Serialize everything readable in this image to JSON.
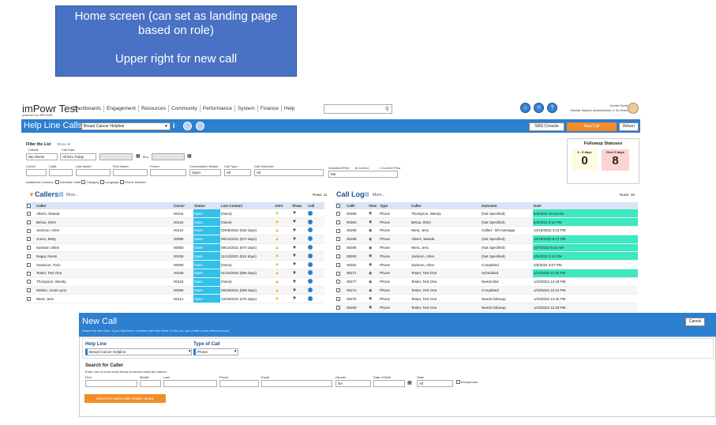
{
  "callout": {
    "line1": "Home screen (can set as landing page",
    "line2": "based on role)",
    "line3": "",
    "line4": "Upper right for new call"
  },
  "app": {
    "logo": "imPowr Test",
    "logo_sub": "powered by IMPOWR",
    "nav": [
      "Dashboards",
      "Engagement",
      "Resources",
      "Community",
      "Performance",
      "System",
      "Finance",
      "Help"
    ],
    "user_name": "Kenish Scott",
    "user_role": "Suicide System Administrator (+ ID Hide)"
  },
  "bar": {
    "title": "Help Line Calls",
    "helpline": "Breast Cancer Helpline",
    "sms": "SMS Console",
    "new_call": "New Call",
    "return": "Return"
  },
  "filter": {
    "title": "Filter the List",
    "show_all": "Show All",
    "clients_label": "Clients:",
    "calldate_label": "Call Date:",
    "clients_value": "My clients",
    "calldate_value": "All thru Today",
    "thru": "thru",
    "conv_label": "Conv#:",
    "call_label": "Call#:",
    "last_label": "Last Name:",
    "first_label": "First Name:",
    "phone_label": "Phone:",
    "convstatus_label": "Conversation Status:",
    "calltype_label": "Call Type:",
    "outcome_label": "Call Outcome:",
    "convstatus_value": "Open",
    "calltype_value": "All",
    "outcome_value": "All",
    "volpeer_label": "Volunteer/Peer:",
    "current": "Current",
    "currentprior": "Current+Prior",
    "volpeer_value": "Me",
    "addl_label": "Additional Columns:",
    "addl": [
      "Volunteer Note",
      "Category",
      "Language",
      "Phone Number"
    ]
  },
  "followup": {
    "title": "Followup Statuses",
    "a_label": "3 - 5 days",
    "a_value": "0",
    "b_label": "Over 5 days",
    "b_value": "8"
  },
  "callers": {
    "title": "Callers",
    "more": "More...",
    "rows_label": "Rows: 11",
    "headers": [
      "Caller",
      "Conv#",
      "Status",
      "Live Contact",
      "Attn!",
      "Show",
      "Call"
    ],
    "rows": [
      [
        "Albers, Wanda",
        "00115",
        "Open",
        "(None)"
      ],
      [
        "Below, Sheri",
        "00116",
        "Open",
        "(None)"
      ],
      [
        "Jackson, Arlen",
        "00110",
        "Open",
        "02/08/2022 (532 days)"
      ],
      [
        "Jones, Betty",
        "00085",
        "Open",
        "09/14/2021 (674 days)"
      ],
      [
        "Kamben, Ellen",
        "00083",
        "Open",
        "09/14/2021 (674 days)"
      ],
      [
        "Nagai, Itsumi",
        "00106",
        "Open",
        "11/14/2021 (615 days)"
      ],
      [
        "Swanson, Torin",
        "00093",
        "Open",
        "(None)"
      ],
      [
        "Tester, Test One",
        "00108",
        "Open",
        "01/10/2022 (556 days)"
      ],
      [
        "Thompson, Wendy",
        "00119",
        "Open",
        "(None)"
      ],
      [
        "Walton, Annie Lynn",
        "00080",
        "Open",
        "09/29/2021 (659 days)"
      ],
      [
        "West, Jess",
        "00114",
        "Open",
        "10/18/2022 (275 days)"
      ]
    ]
  },
  "calllog": {
    "title": "Call Log",
    "more": "More...",
    "rows_label": "Rows: 18",
    "headers": [
      "Call#",
      "View",
      "Type",
      "Caller",
      "Outcome",
      "Date"
    ],
    "rows": [
      [
        "00306",
        "Phone",
        "Thompson, Wendy",
        "(Not Specified)",
        "5/3/2023 10:18 AM"
      ],
      [
        "00300",
        "Phone",
        "Below, Sheri",
        "(Not Specified)",
        "5/3/2023 2:15 PM"
      ],
      [
        "00299",
        "Phone",
        "West, Jess",
        "Called - left message",
        "10/18/2022 3:15 PM"
      ],
      [
        "00298",
        "Phone",
        "Albers, Wanda",
        "(Not Specified)",
        "10/18/2022 9:17 PM"
      ],
      [
        "00295",
        "Phone",
        "West, Jess",
        "(Not Specified)",
        "10/7/2022 9:16 AM"
      ],
      [
        "00282",
        "Phone",
        "Jackson, Arlen",
        "(Not Specified)",
        "2/5/2022 3:13 PM"
      ],
      [
        "00281",
        "Phone",
        "Jackson, Arlen",
        "Completed",
        "2/5/2022 3:07 PM"
      ],
      [
        "00271",
        "Phone",
        "Tester, Test One",
        "Scheduled",
        "1/10/2022 11:00 PM"
      ],
      [
        "00277",
        "Phone",
        "Tester, Test One",
        "Needs Met",
        "1/10/2022 12:49 PM"
      ],
      [
        "00272",
        "Phone",
        "Tester, Test One",
        "Completed",
        "1/10/2022 12:31 PM"
      ],
      [
        "00270",
        "Phone",
        "Tester, Test One",
        "Needs followup",
        "1/10/2022 12:30 PM"
      ],
      [
        "00269",
        "Phone",
        "Tester, Test One",
        "Needs followup",
        "1/10/2022 12:29 PM"
      ]
    ]
  },
  "newcall": {
    "title": "New Call",
    "subtitle": "Search for the client. If you find them, continue with that client. If not, you can create a new client account.",
    "cancel": "Cancel",
    "helpline_label": "Help Line",
    "helpline_value": "Breast Cancer Helpline",
    "type_label": "Type of Call",
    "type_value": "Phone",
    "search_title": "Search for Caller",
    "search_hint": "Enter one or more items below to narrow down the search.",
    "first": "First",
    "middle": "Middle",
    "last": "Last",
    "phone": "Phone",
    "email": "Email",
    "gender": "Gender",
    "gender_value": "NA",
    "dob": "Date of Birth",
    "state": "State",
    "state_value": "All",
    "anonymous": "Anonymous",
    "check_btn": "Check for Callers with similar names"
  },
  "colors": {
    "blue": "#2d7fd0",
    "orange": "#f28c28",
    "open": "#32c0ea",
    "highlight": "#3ee8c0"
  }
}
